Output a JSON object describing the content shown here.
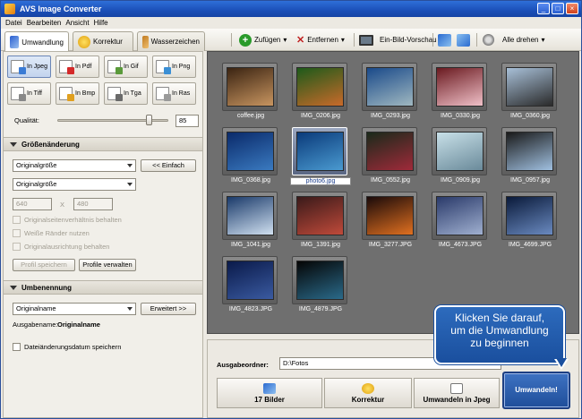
{
  "window": {
    "title": "AVS Image Converter",
    "controls": [
      "_",
      "□",
      "×"
    ]
  },
  "menu": [
    "Datei",
    "Bearbeiten",
    "Ansicht",
    "Hilfe"
  ],
  "tabs": [
    {
      "label": "Umwandlung",
      "icon": "convert-icon"
    },
    {
      "label": "Korrektur",
      "icon": "star-icon"
    },
    {
      "label": "Wasserzeichen",
      "icon": "stamp-icon"
    }
  ],
  "toolbar": {
    "add_label": "Zufügen",
    "remove_label": "Entfernen",
    "preview_label": "Ein-Bild-Vorschau",
    "rotate_all_label": "Alle drehen"
  },
  "formats": [
    {
      "label": "In Jpeg",
      "color": "#3a7bd5",
      "active": true
    },
    {
      "label": "In Pdf",
      "color": "#d42a2a",
      "active": false
    },
    {
      "label": "In Gif",
      "color": "#5a9a3a",
      "active": false
    },
    {
      "label": "In Png",
      "color": "#3a8fd5",
      "active": false
    },
    {
      "label": "In Tiff",
      "color": "#888888",
      "active": false
    },
    {
      "label": "In Bmp",
      "color": "#e0a020",
      "active": false
    },
    {
      "label": "In Tga",
      "color": "#6a6a6a",
      "active": false
    },
    {
      "label": "In Ras",
      "color": "#9a9a9a",
      "active": false
    }
  ],
  "quality": {
    "label": "Qualität:",
    "value": "85",
    "level": 85
  },
  "resize": {
    "section_title": "Größenänderung",
    "preset": "Originalgröße",
    "simple_button": "<< Einfach",
    "mode": "Originalgröße",
    "width": "640",
    "times": "X",
    "height": "480",
    "keep_ratio": "Originalseitenverhältnis behalten",
    "white_borders": "Weiße Ränder nutzen",
    "keep_orientation": "Originalausrichtung behalten",
    "save_profile": "Profil speichern",
    "manage_profiles": "Profile verwalten"
  },
  "rename": {
    "section_title": "Umbenennung",
    "mode": "Originalname",
    "advanced_button": "Erweitert >>",
    "output_label": "Ausgabename:",
    "output_value": "Originalname"
  },
  "keep_date": "Dateiänderungsdatum speichern",
  "thumbnails": [
    {
      "name": "coffee.jpg",
      "colors": [
        "#3b2412",
        "#c89560"
      ]
    },
    {
      "name": "IMG_0206.jpg",
      "colors": [
        "#1d5a1a",
        "#c96a2a"
      ]
    },
    {
      "name": "IMG_0293.jpg",
      "colors": [
        "#1a4a8a",
        "#a0b8c0"
      ]
    },
    {
      "name": "IMG_0330.jpg",
      "colors": [
        "#6a1a20",
        "#f0c0c8"
      ]
    },
    {
      "name": "IMG_0360.jpg",
      "colors": [
        "#a8c0d8",
        "#2a2a2a"
      ]
    },
    {
      "name": "IMG_0368.jpg",
      "colors": [
        "#0a2a6a",
        "#3a7ac0"
      ]
    },
    {
      "name": "photo6.jpg",
      "colors": [
        "#0a3a7a",
        "#4a9ad0"
      ]
    },
    {
      "name": "IMG_0552.jpg",
      "colors": [
        "#1a2a1a",
        "#a02a3a"
      ]
    },
    {
      "name": "IMG_0909.jpg",
      "colors": [
        "#c8e0e8",
        "#6a8a9a"
      ]
    },
    {
      "name": "IMG_0957.jpg",
      "colors": [
        "#1a1a1a",
        "#a0c0e0"
      ]
    },
    {
      "name": "IMG_1041.jpg",
      "colors": [
        "#1a3a6a",
        "#d0e0f0"
      ]
    },
    {
      "name": "IMG_1391.jpg",
      "colors": [
        "#3a1a1a",
        "#c04a3a"
      ]
    },
    {
      "name": "IMG_3277.JPG",
      "colors": [
        "#1a0a0a",
        "#e07020"
      ]
    },
    {
      "name": "IMG_4673.JPG",
      "colors": [
        "#2a3a6a",
        "#a0b0d0"
      ]
    },
    {
      "name": "IMG_4699.JPG",
      "colors": [
        "#0a1a3a",
        "#6a8ac0"
      ]
    },
    {
      "name": "IMG_4823.JPG",
      "colors": [
        "#0a1a4a",
        "#3a5aa0"
      ]
    },
    {
      "name": "IMG_4879.JPG",
      "colors": [
        "#050505",
        "#2a6a8a"
      ]
    }
  ],
  "selected_thumbnail": "photo6.jpg",
  "output": {
    "label": "Ausgabeordner:",
    "path": "D:\\Fotos"
  },
  "steps": [
    {
      "label": "17 Bilder",
      "icon": "images-icon"
    },
    {
      "label": "Korrektur",
      "icon": "star-icon"
    },
    {
      "label": "Umwandeln in Jpeg",
      "icon": "jpeg-icon"
    }
  ],
  "convert_button": "Umwandeln!",
  "callout": {
    "line1": "Klicken Sie darauf,",
    "line2": "um die Umwandlung",
    "line3": "zu beginnen"
  }
}
